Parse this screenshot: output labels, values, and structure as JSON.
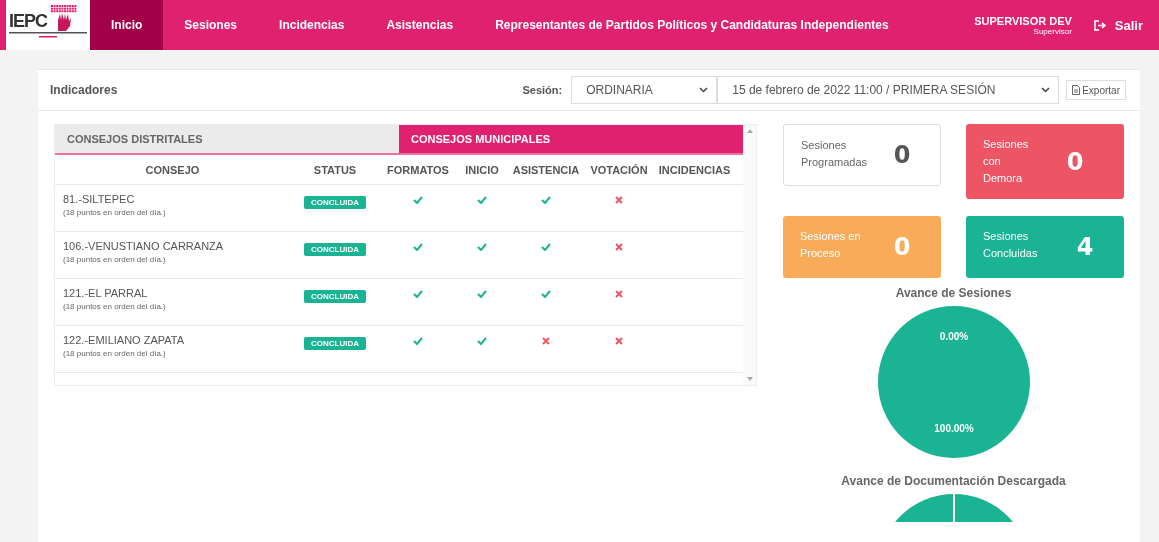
{
  "logo": {
    "acronym": "IEPC"
  },
  "nav": [
    {
      "label": "Inicio",
      "selected": true
    },
    {
      "label": "Sesiones",
      "selected": false
    },
    {
      "label": "Incidencias",
      "selected": false
    },
    {
      "label": "Asistencias",
      "selected": false
    },
    {
      "label": "Representantes de Partidos Políticos y Candidaturas Independientes",
      "selected": false
    }
  ],
  "user": {
    "name": "SUPERVISOR DEV",
    "role": "Supervisor"
  },
  "logout": "Salir",
  "header": {
    "title": "Indicadores",
    "session_label": "Sesión:",
    "session_type": "ORDINARIA",
    "session_date": "15 de febrero de 2022 11:00 / PRIMERA SESIÓN",
    "export": "Exportar"
  },
  "tabs": [
    {
      "label": "CONSEJOS DISTRITALES",
      "selected": false
    },
    {
      "label": "CONSEJOS MUNICIPALES",
      "selected": true
    }
  ],
  "columns": [
    "CONSEJO",
    "STATUS",
    "FORMATOS",
    "INICIO",
    "ASISTENCIA",
    "VOTACIÓN",
    "INCIDENCIAS"
  ],
  "rows": [
    {
      "name": "81.-SILTEPEC",
      "note": "(18 puntos en orden del día.)",
      "status": "CONCLUIDA",
      "formatos": true,
      "inicio": true,
      "asistencia": true,
      "votacion": false
    },
    {
      "name": "106.-VENUSTIANO CARRANZA",
      "note": "(18 puntos en orden del día.)",
      "status": "CONCLUIDA",
      "formatos": true,
      "inicio": true,
      "asistencia": true,
      "votacion": false
    },
    {
      "name": "121.-EL PARRAL",
      "note": "(18 puntos en orden del día.)",
      "status": "CONCLUIDA",
      "formatos": true,
      "inicio": true,
      "asistencia": true,
      "votacion": false
    },
    {
      "name": "122.-EMILIANO ZAPATA",
      "note": "(18 puntos en orden del día.)",
      "status": "CONCLUIDA",
      "formatos": true,
      "inicio": true,
      "asistencia": false,
      "votacion": false
    }
  ],
  "stats": [
    {
      "label": "Sesiones Programadas",
      "value": "0",
      "color": "#ffffff"
    },
    {
      "label": "Sesiones con Demora",
      "value": "0",
      "color": "#ed5565"
    },
    {
      "label": "Sesiones en Proceso",
      "value": "0",
      "color": "#f8ac59"
    },
    {
      "label": "Sesiones Concluidas",
      "value": "4",
      "color": "#1ab394"
    }
  ],
  "charts": [
    {
      "title": "Avance de Sesiones",
      "chart_data": {
        "type": "pie",
        "values": [
          0,
          100
        ],
        "value_labels": [
          "0.00%",
          "100.00%"
        ]
      }
    },
    {
      "title": "Avance de Documentación Descargada"
    }
  ]
}
